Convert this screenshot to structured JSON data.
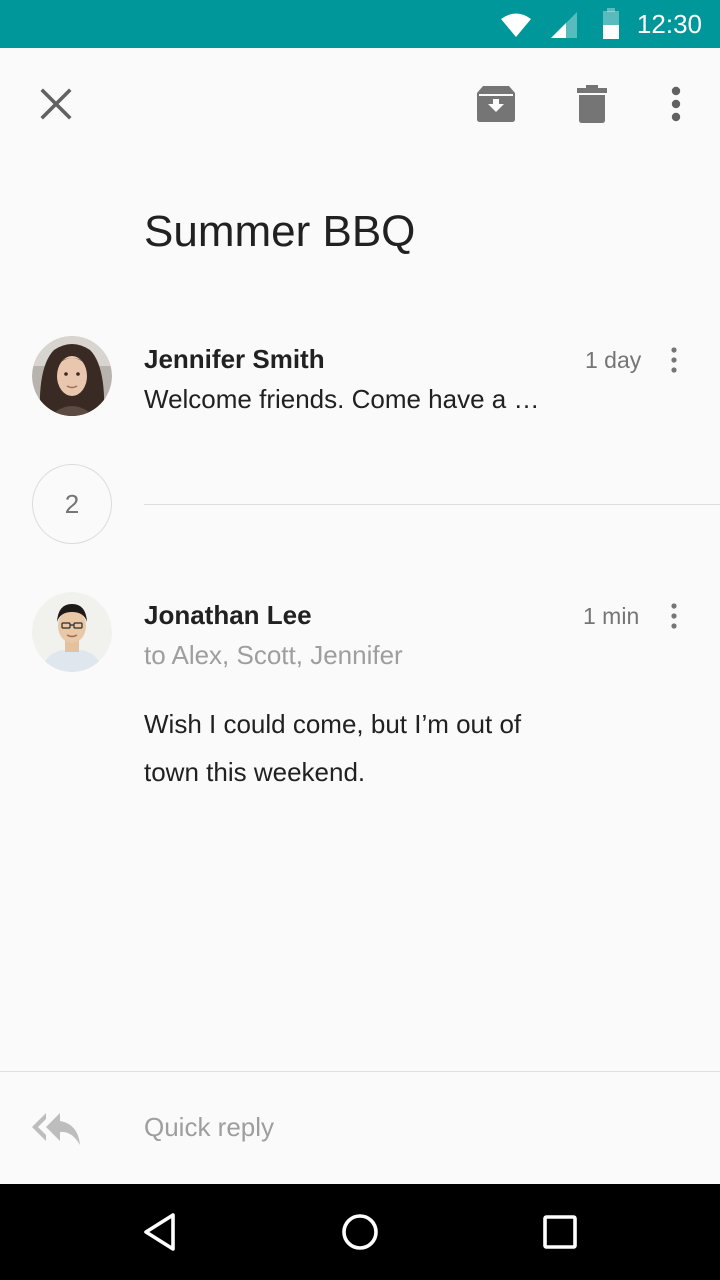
{
  "status_bar": {
    "time": "12:30",
    "icons": [
      "wifi-icon",
      "cellular-signal-icon",
      "battery-icon"
    ],
    "background": "#00979a"
  },
  "toolbar": {
    "icons": [
      "close-icon",
      "archive-icon",
      "delete-icon",
      "more-vert-icon"
    ]
  },
  "thread": {
    "subject": "Summer BBQ",
    "collapsed_count": "2",
    "messages": [
      {
        "sender": "Jennifer Smith",
        "time": "1 day",
        "snippet": "Welcome friends. Come have a …"
      },
      {
        "sender": "Jonathan Lee",
        "time": "1 min",
        "recipients": "to Alex, Scott, Jennifer",
        "body_line_1": "Wish I could come, but I’m out of",
        "body_line_2": "town this weekend."
      }
    ]
  },
  "quick_reply": {
    "icon": "reply-all-icon",
    "label": "Quick reply"
  },
  "nav_bar": {
    "icons": [
      "back-icon",
      "home-icon",
      "recents-icon"
    ]
  },
  "colors": {
    "accent": "#00979a",
    "icon_gray": "#757575",
    "secondary_text": "#9e9e9e"
  }
}
